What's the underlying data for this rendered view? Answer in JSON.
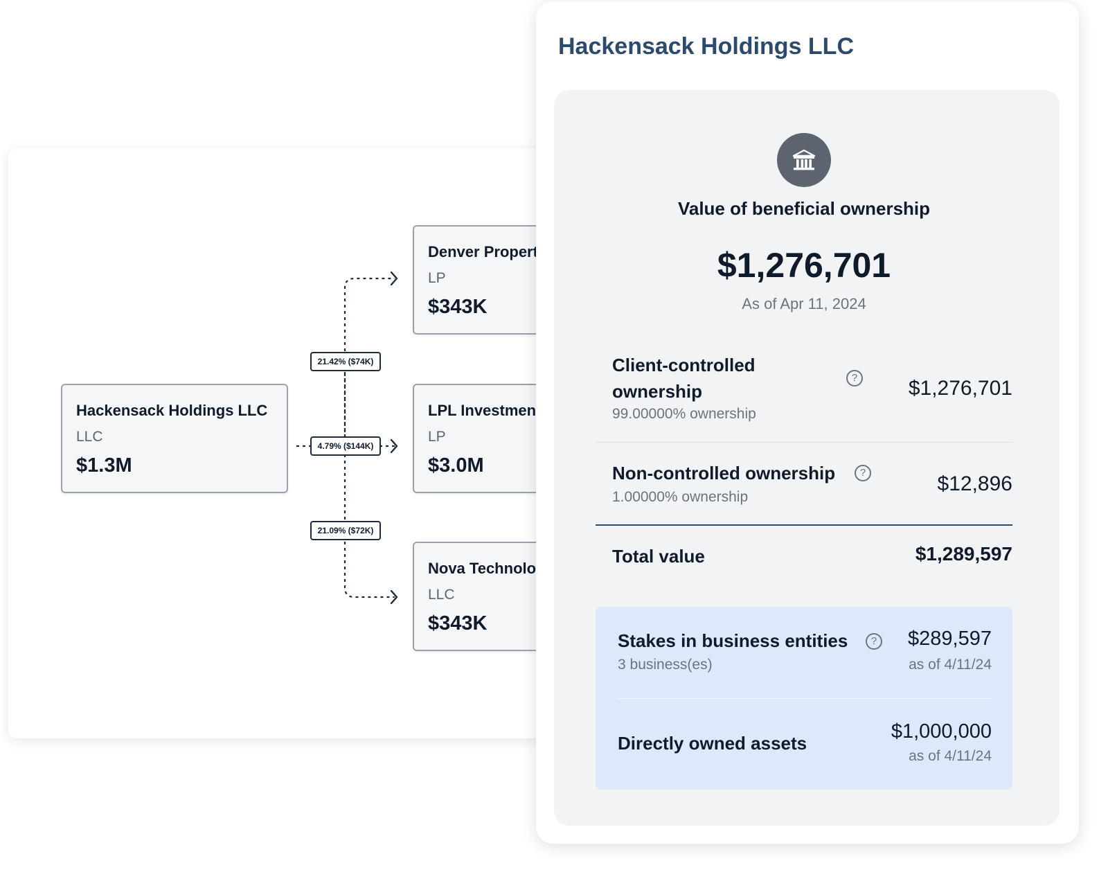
{
  "diagram": {
    "source": {
      "name": "Hackensack Holdings LLC",
      "type": "LLC",
      "value": "$1.3M"
    },
    "targets": [
      {
        "name": "Denver Properties",
        "type": "LP",
        "value": "$343K",
        "edge_label": "21.42% ($74K)"
      },
      {
        "name": "LPL Investments",
        "type": "LP",
        "value": "$3.0M",
        "edge_label": "4.79% ($144K)"
      },
      {
        "name": "Nova Technologies",
        "type": "LLC",
        "value": "$343K",
        "edge_label": "21.09% ($72K)"
      }
    ]
  },
  "panel": {
    "title": "Hackensack Holdings LLC",
    "icon": "bank-icon",
    "section_title": "Value of beneficial ownership",
    "total_value": "$1,276,701",
    "as_of": "As of Apr 11, 2024",
    "rows": [
      {
        "label_line1": "Client-controlled",
        "label_line2": "ownership",
        "sub": "99.00000% ownership",
        "value": "$1,276,701"
      },
      {
        "label": "Non-controlled ownership",
        "sub": "1.00000% ownership",
        "value": "$12,896"
      }
    ],
    "total": {
      "label": "Total value",
      "value": "$1,289,597"
    },
    "breakdown": [
      {
        "label": "Stakes in business entities",
        "sub": "3 business(es)",
        "value": "$289,597",
        "date": "as of 4/11/24"
      },
      {
        "label": "Directly owned assets",
        "value": "$1,000,000",
        "date": "as of 4/11/24"
      }
    ]
  },
  "colors": {
    "title_blue": "#2a4a6e",
    "panel_bg": "#f2f3f5",
    "highlight_bg": "#dde9fb",
    "icon_bg": "#5d6470",
    "text_dark": "#0f1b2a",
    "text_muted": "#6b737e"
  }
}
